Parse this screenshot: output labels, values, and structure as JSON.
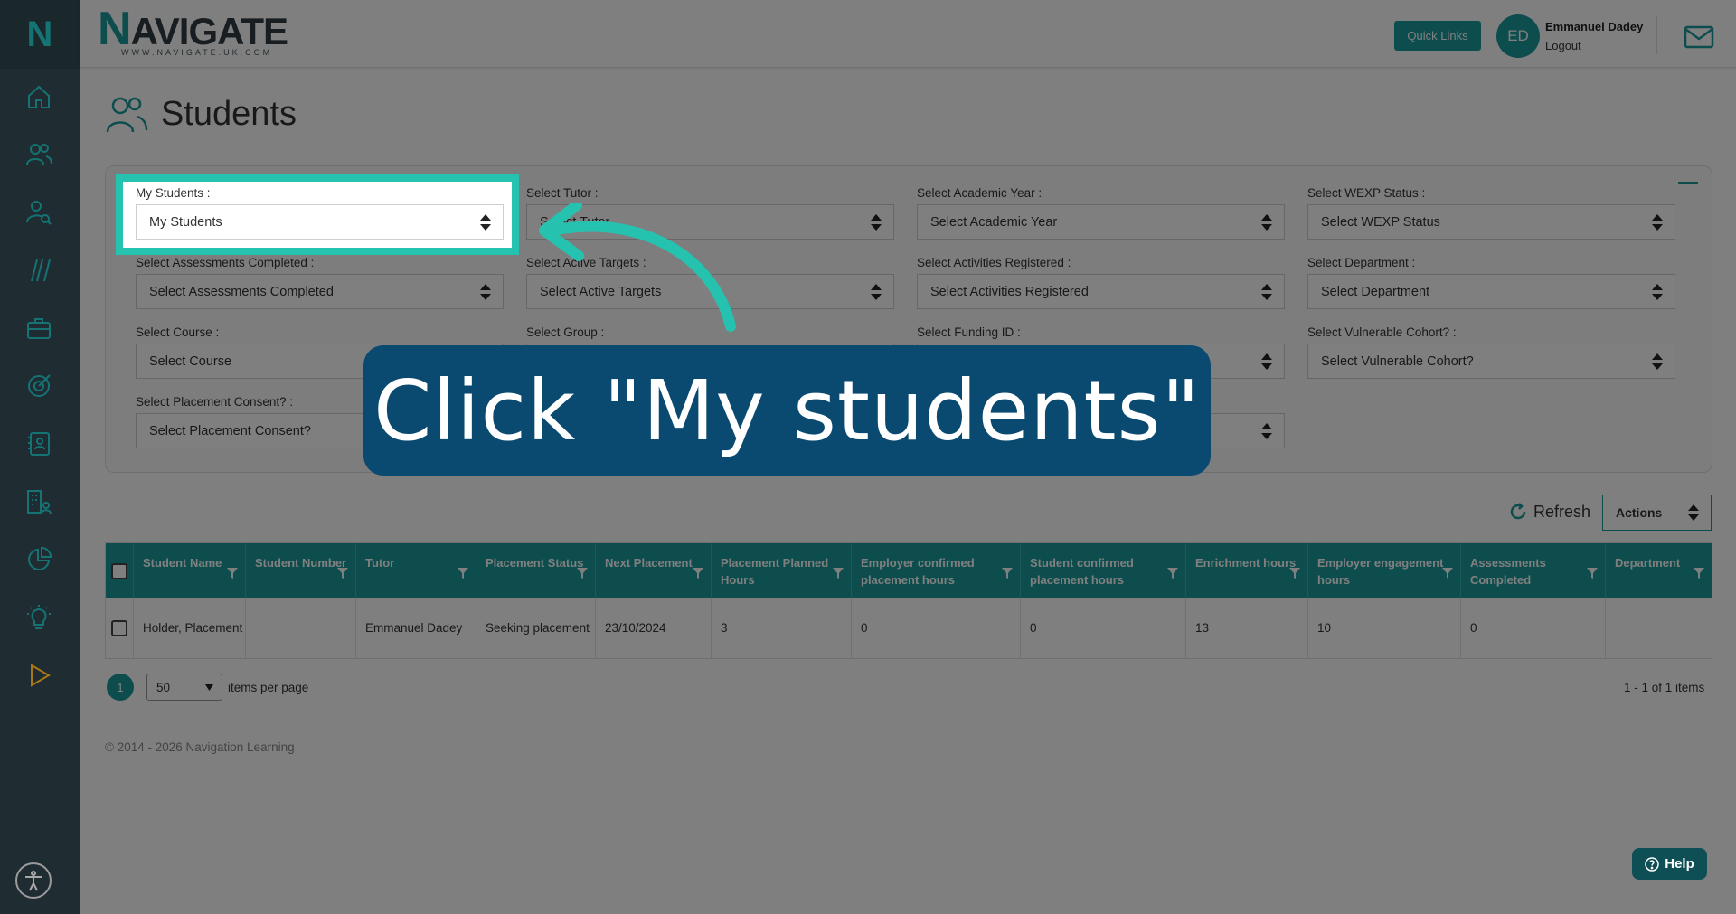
{
  "brand": {
    "name_rest": "AVIGATE",
    "name_initial": "N",
    "tagline": "WWW.NAVIGATE.UK.COM",
    "side_initial": "N"
  },
  "header": {
    "quick_links": "Quick Links",
    "avatar_initials": "ED",
    "user_name": "Emmanuel Dadey",
    "logout": "Logout"
  },
  "page": {
    "title": "Students"
  },
  "filters": [
    {
      "label": "My Students :",
      "value": "My Students"
    },
    {
      "label": "Select Tutor :",
      "value": "Select Tutor"
    },
    {
      "label": "Select Academic Year :",
      "value": "Select Academic Year"
    },
    {
      "label": "Select WEXP Status :",
      "value": "Select WEXP Status"
    },
    {
      "label": "Select Assessments Completed :",
      "value": "Select Assessments Completed"
    },
    {
      "label": "Select Active Targets :",
      "value": "Select Active Targets"
    },
    {
      "label": "Select Activities Registered :",
      "value": "Select Activities Registered"
    },
    {
      "label": "Select Department :",
      "value": "Select Department"
    },
    {
      "label": "Select Course :",
      "value": "Select Course"
    },
    {
      "label": "Select Group :",
      "value": ""
    },
    {
      "label": "Select Funding ID :",
      "value": ""
    },
    {
      "label": "Select Vulnerable Cohort? :",
      "value": "Select Vulnerable Cohort?"
    },
    {
      "label": "Select Placement Consent? :",
      "value": "Select Placement Consent?"
    }
  ],
  "toolbar": {
    "refresh": "Refresh",
    "actions": "Actions"
  },
  "table": {
    "headers": [
      "Student Name",
      "Student Number",
      "Tutor",
      "Placement Status",
      "Next Placement",
      "Placement Planned Hours",
      "Employer confirmed placement hours",
      "Student confirmed placement hours",
      "Enrichment hours",
      "Employer engagement hours",
      "Assessments Completed",
      "Department"
    ],
    "rows": [
      [
        "Holder, Placement",
        "",
        "Emmanuel Dadey",
        "Seeking placement",
        "23/10/2024",
        "3",
        "0",
        "0",
        "13",
        "10",
        "0",
        ""
      ]
    ]
  },
  "pager": {
    "current_page": "1",
    "page_size": "50",
    "per_page_label": "items per page",
    "count": "1 - 1 of 1 items"
  },
  "footer": {
    "copyright": "© 2014 - 2026 Navigation Learning"
  },
  "help": {
    "label": "Help"
  },
  "callout": {
    "text": "Click \"My students\""
  },
  "colors": {
    "teal": "#1c9a9a",
    "sidebar": "#2a3b42",
    "callout": "#0b4a70",
    "highlight": "#26c2b0"
  }
}
